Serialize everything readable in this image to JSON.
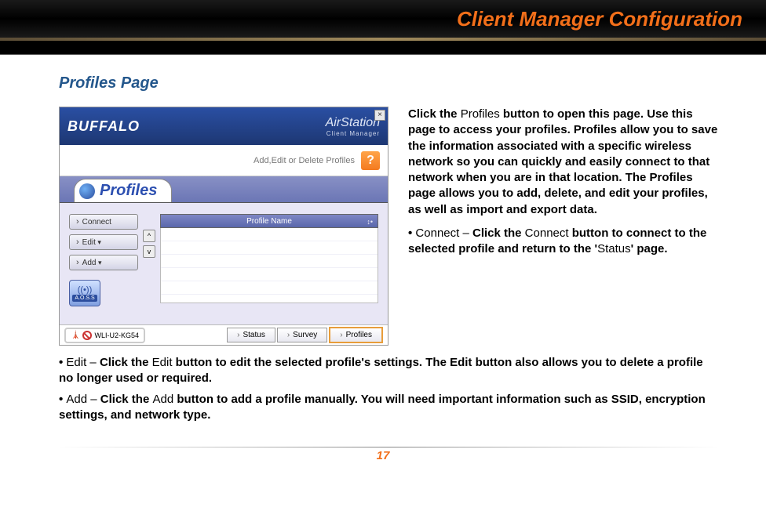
{
  "header": {
    "title": "Client Manager Configuration"
  },
  "section_title": "Profiles Page",
  "app": {
    "brand": "BUFFALO",
    "product": "AirStation",
    "product_sub": "Client Manager",
    "close_label": "×",
    "subtitle": "Add,Edit or Delete Profiles",
    "help_label": "?",
    "active_tab": "Profiles",
    "buttons": {
      "connect": "Connect",
      "edit": "Edit",
      "add": "Add"
    },
    "pager": {
      "up": "^",
      "down": "v"
    },
    "list_header": "Profile Name",
    "sort_glyph": "↕•",
    "aoss_label": "A.O.S.S",
    "device": "WLI-U2-KG54",
    "footer_tabs": {
      "status": "Status",
      "survey": "Survey",
      "profiles": "Profiles"
    }
  },
  "para_intro": {
    "lead": "Click the ",
    "term": "Profiles",
    "rest": " button to open this page. Use this page to access your profiles. Profiles allow you to save the information associated with a specific wireless network so you can quickly and easily connect to that network when you are in that location. The Profiles page allows you to add, delete, and edit your profiles, as well as import and export data."
  },
  "bullet_connect": {
    "prefix": "• ",
    "term": "Connect –",
    "mid1": " Click the ",
    "term2": "Connect",
    "mid2": " button to connect to the selected profile and return to the '",
    "term3": "Status",
    "tail": "' page."
  },
  "bullet_edit": {
    "prefix": "• ",
    "term": "Edit –",
    "mid1": " Click the ",
    "term2": "Edit",
    "tail": " button to edit the selected profile's settings.  The Edit button also allows you to delete a profile no longer used or required."
  },
  "bullet_add": {
    "prefix": "• ",
    "term": "Add –",
    "mid1": " Click the ",
    "term2": "Add",
    "tail": " button to add a profile manually.  You will need important information such as SSID, encryption settings, and network type."
  },
  "page_number": "17"
}
